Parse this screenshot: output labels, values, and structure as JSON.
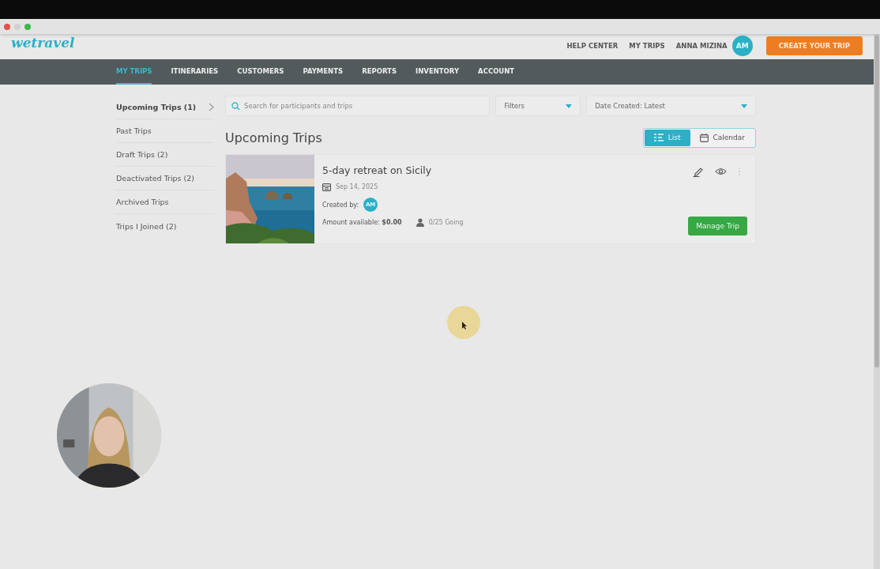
{
  "header": {
    "logo": "wetravel",
    "links": [
      "HELP CENTER",
      "MY TRIPS"
    ],
    "user": {
      "name": "ANNA MIZINA",
      "initials": "AM"
    },
    "cta": "CREATE YOUR TRIP"
  },
  "nav": [
    {
      "label": "MY TRIPS",
      "selected": true
    },
    {
      "label": "ITINERARIES",
      "selected": false
    },
    {
      "label": "CUSTOMERS",
      "selected": false
    },
    {
      "label": "PAYMENTS",
      "selected": false
    },
    {
      "label": "REPORTS",
      "selected": false
    },
    {
      "label": "INVENTORY",
      "selected": false
    },
    {
      "label": "ACCOUNT",
      "selected": false
    }
  ],
  "sidebar": [
    {
      "label": "Upcoming Trips (1)",
      "selected": true
    },
    {
      "label": "Past Trips",
      "selected": false
    },
    {
      "label": "Draft Trips (2)",
      "selected": false
    },
    {
      "label": "Deactivated Trips (2)",
      "selected": false
    },
    {
      "label": "Archived Trips",
      "selected": false
    },
    {
      "label": "Trips I Joined (2)",
      "selected": false
    }
  ],
  "search": {
    "placeholder": "Search for participants and trips"
  },
  "filters": {
    "value": "Filters"
  },
  "sort": {
    "value": "Date Created: Latest"
  },
  "title": "Upcoming Trips",
  "views": [
    {
      "label": "List",
      "kind": "list",
      "selected": true
    },
    {
      "label": "Calendar",
      "kind": "calendar",
      "selected": false
    }
  ],
  "trips": [
    {
      "kind": "picture",
      "title": "5-day retreat on Sicily",
      "date": "Sep 14, 2025",
      "created_by": "Created by:",
      "creator_initials": "AM",
      "amount": "Amount available: **$0.00**",
      "going": "0/25 Going",
      "action": "Manage Trip"
    }
  ]
}
